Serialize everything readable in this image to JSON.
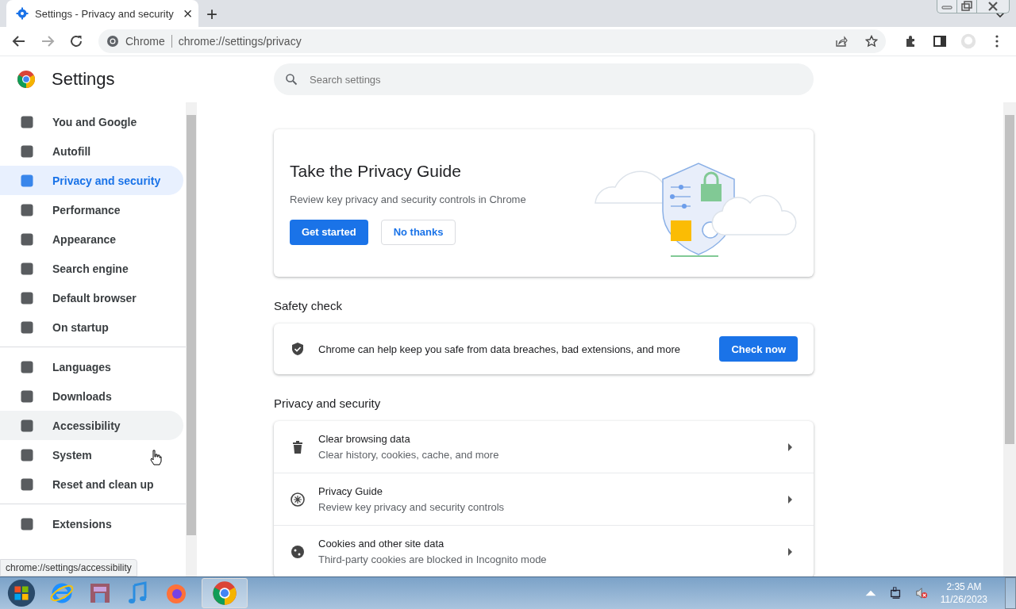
{
  "tab": {
    "title": "Settings - Privacy and security",
    "close": "×",
    "new_tab": "+"
  },
  "toolbar": {
    "site_label": "Chrome",
    "url": "chrome://settings/privacy"
  },
  "settings": {
    "title": "Settings",
    "search": {
      "placeholder": "Search settings"
    }
  },
  "sidebar": {
    "groups": [
      [
        {
          "label": "You and Google",
          "selected": false,
          "hovered": false
        },
        {
          "label": "Autofill",
          "selected": false,
          "hovered": false
        },
        {
          "label": "Privacy and security",
          "selected": true,
          "hovered": false
        },
        {
          "label": "Performance",
          "selected": false,
          "hovered": false
        },
        {
          "label": "Appearance",
          "selected": false,
          "hovered": false
        },
        {
          "label": "Search engine",
          "selected": false,
          "hovered": false
        },
        {
          "label": "Default browser",
          "selected": false,
          "hovered": false
        },
        {
          "label": "On startup",
          "selected": false,
          "hovered": false
        }
      ],
      [
        {
          "label": "Languages",
          "selected": false,
          "hovered": false
        },
        {
          "label": "Downloads",
          "selected": false,
          "hovered": false
        },
        {
          "label": "Accessibility",
          "selected": false,
          "hovered": true
        },
        {
          "label": "System",
          "selected": false,
          "hovered": false
        },
        {
          "label": "Reset and clean up",
          "selected": false,
          "hovered": false
        }
      ],
      [
        {
          "label": "Extensions",
          "selected": false,
          "hovered": false
        }
      ]
    ]
  },
  "guide_card": {
    "title": "Take the Privacy Guide",
    "text": "Review key privacy and security controls in Chrome",
    "primary": "Get started",
    "secondary": "No thanks"
  },
  "safety_check": {
    "heading": "Safety check",
    "text": "Chrome can help keep you safe from data breaches, bad extensions, and more",
    "button": "Check now"
  },
  "privacy": {
    "heading": "Privacy and security",
    "rows": [
      {
        "title": "Clear browsing data",
        "subtitle": "Clear history, cookies, cache, and more"
      },
      {
        "title": "Privacy Guide",
        "subtitle": "Review key privacy and security controls"
      },
      {
        "title": "Cookies and other site data",
        "subtitle": "Third-party cookies are blocked in Incognito mode"
      }
    ]
  },
  "status_tooltip": "chrome://settings/accessibility",
  "taskbar": {
    "time": "2:35 AM",
    "date": "11/26/2023"
  }
}
